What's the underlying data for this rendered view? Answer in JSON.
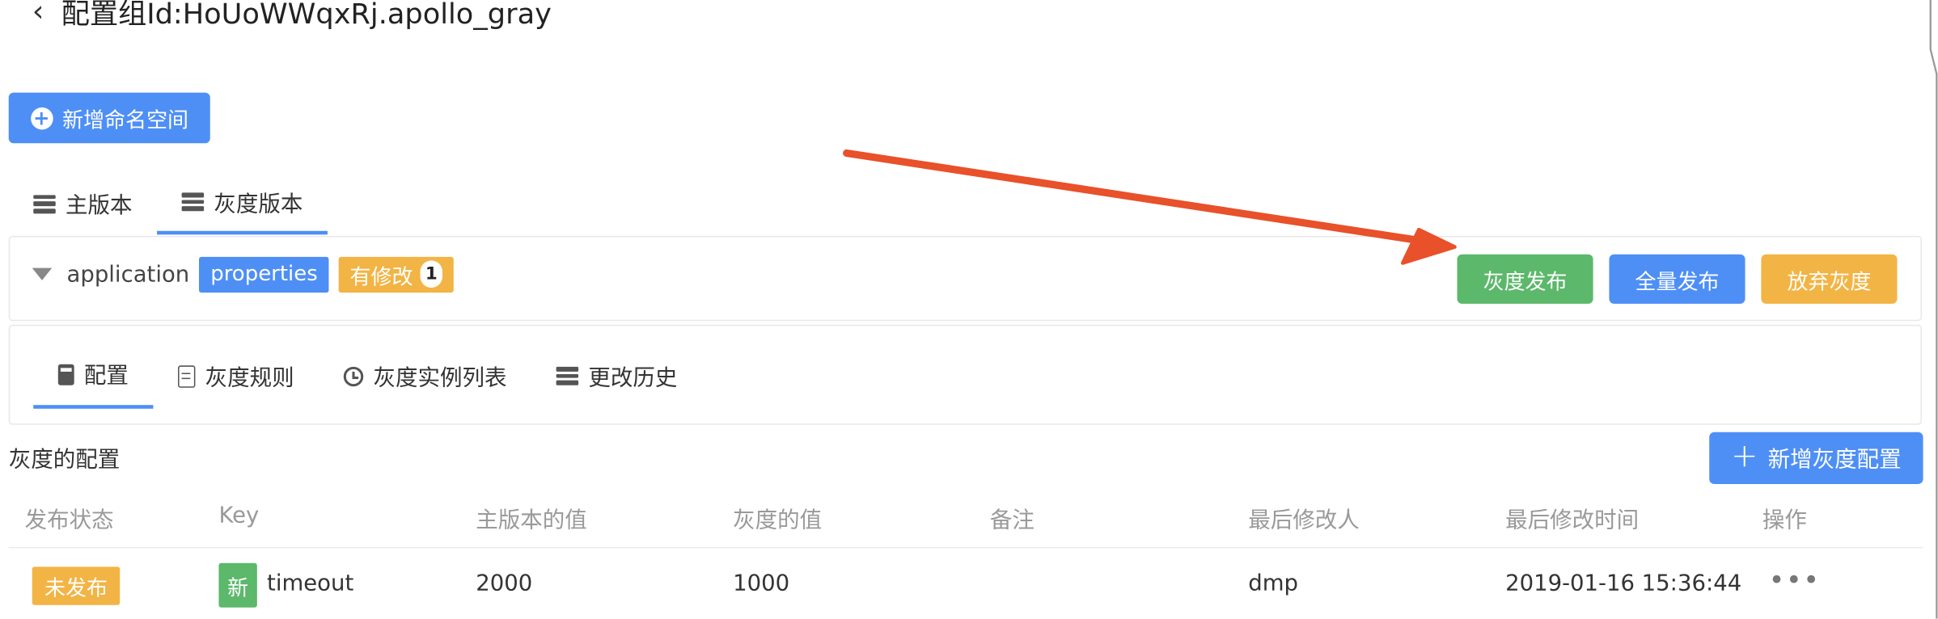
{
  "header": {
    "back_icon": "chevron-left-icon",
    "title": "配置组Id:HoUoWWqxRj.apollo_gray"
  },
  "add_namespace_button": {
    "label": "新增命名空间",
    "icon": "plus-circle-icon"
  },
  "top_tabs": [
    {
      "label": "主版本",
      "icon": "server-icon",
      "active": false
    },
    {
      "label": "灰度版本",
      "icon": "server-icon",
      "active": true
    }
  ],
  "namespace": {
    "name": "application",
    "format_tag": "properties",
    "modified_tag": "有修改",
    "modified_count": "1"
  },
  "actions": {
    "gray_publish": "灰度发布",
    "full_publish": "全量发布",
    "discard_gray": "放弃灰度"
  },
  "sub_tabs": [
    {
      "label": "配置",
      "icon": "calculator-icon",
      "active": true
    },
    {
      "label": "灰度规则",
      "icon": "file-text-icon",
      "active": false
    },
    {
      "label": "灰度实例列表",
      "icon": "history-icon",
      "active": false
    },
    {
      "label": "更改历史",
      "icon": "server-icon",
      "active": false
    }
  ],
  "config_section": {
    "title": "灰度的配置",
    "add_button": "新增灰度配置"
  },
  "table": {
    "columns": [
      "发布状态",
      "Key",
      "主版本的值",
      "灰度的值",
      "备注",
      "最后修改人",
      "最后修改时间",
      "操作"
    ],
    "rows": [
      {
        "status": "未发布",
        "new_tag": "新",
        "key": "timeout",
        "master_value": "2000",
        "gray_value": "1000",
        "comment": "",
        "modifier": "dmp",
        "modified_time": "2019-01-16 15:36:44",
        "op": "•••"
      }
    ]
  },
  "colors": {
    "primary": "#4e8ff6",
    "success": "#5cb86a",
    "warning": "#f2b444",
    "annotation_arrow": "#e8512a"
  }
}
